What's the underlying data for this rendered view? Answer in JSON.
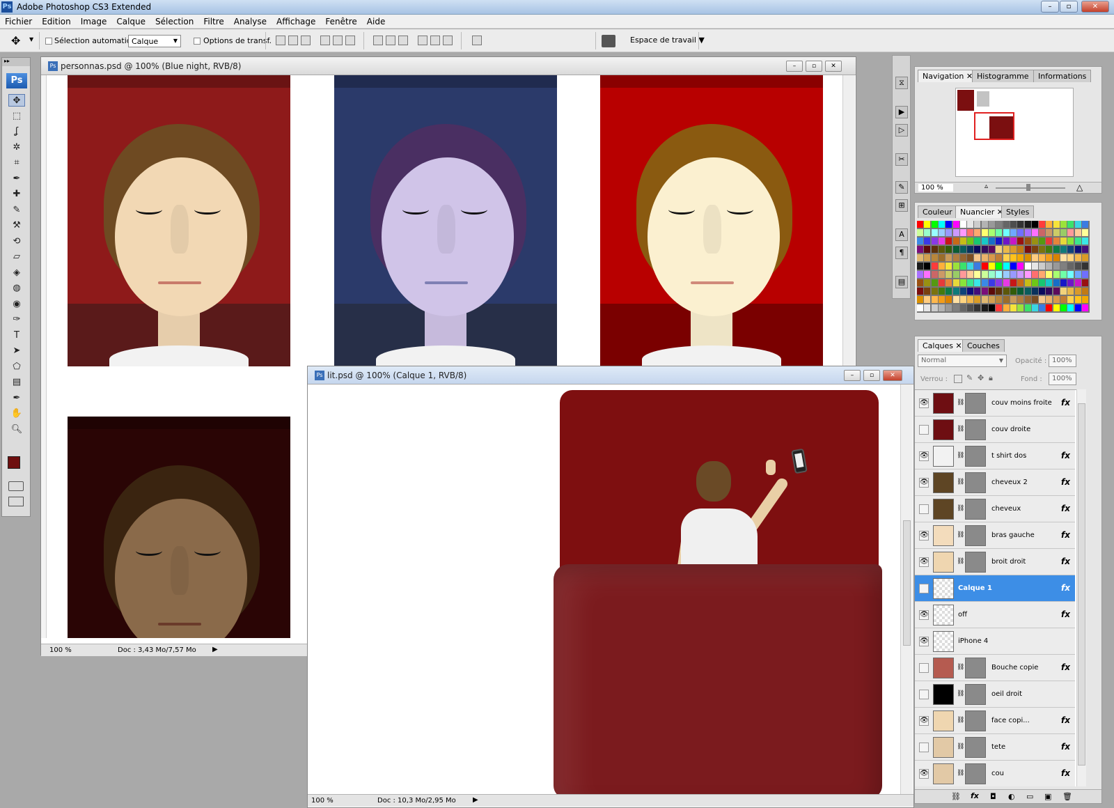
{
  "app": {
    "title": "Adobe Photoshop CS3 Extended",
    "icon": "ps-icon"
  },
  "window_controls": {
    "minimize": "–",
    "maximize": "▫",
    "close": "✕"
  },
  "menu": [
    "Fichier",
    "Edition",
    "Image",
    "Calque",
    "Sélection",
    "Filtre",
    "Analyse",
    "Affichage",
    "Fenêtre",
    "Aide"
  ],
  "options": {
    "auto_select_label": "Sélection automatique :",
    "auto_select_value": "Calque",
    "transform_label": "Options de transf.",
    "workspace_label": "Espace de travail ▼"
  },
  "toolbox": {
    "logo": "Ps",
    "tools": [
      "move-tool",
      "marquee-tool",
      "lasso-tool",
      "magic-wand-tool",
      "crop-tool",
      "eyedropper-tool",
      "healing-brush-tool",
      "brush-tool",
      "clone-stamp-tool",
      "history-brush-tool",
      "eraser-tool",
      "paint-bucket-tool",
      "blur-tool",
      "dodge-tool",
      "pen-tool",
      "type-tool",
      "path-selection-tool",
      "shape-tool",
      "notes-tool",
      "eyedropper-2-tool",
      "hand-tool",
      "zoom-tool"
    ],
    "foreground": "#6e0f0f",
    "background": "#d9d9d9"
  },
  "doc1": {
    "title": "personnas.psd @ 100% (Blue night, RVB/8)",
    "zoom": "100 %",
    "doc_info": "Doc : 3,43 Mo/7,57 Mo",
    "portraits": [
      {
        "bg": "#8e1a1a",
        "lower": "#5a1a1a",
        "hair": "#6e4a22",
        "face": "#f2d8b4",
        "lips": "#c87a6a"
      },
      {
        "bg": "#2b3a6a",
        "lower": "#272f48",
        "hair": "#4a2f62",
        "face": "#d0c4e8",
        "lips": "#7f80b4"
      },
      {
        "bg": "#b80000",
        "lower": "#7a0000",
        "hair": "#8a5a10",
        "face": "#fbf0d0",
        "lips": "#d08a7a"
      },
      {
        "bg": "#2a0505",
        "lower": "#1f0404",
        "hair": "#3a2410",
        "face": "#8a6a4a",
        "lips": "#6a3a2a"
      }
    ]
  },
  "doc2": {
    "title": "lit.psd @ 100% (Calque 1, RVB/8)",
    "zoom": "100 %",
    "doc_info": "Doc : 10,3 Mo/2,95 Mo",
    "bed_color": "#7e0f10",
    "blanket_color": "#7b1b1e",
    "shirt_color": "#f0f0f0",
    "hair_color": "#6a4a26",
    "skin_color": "#e9cfa6"
  },
  "nav_panel": {
    "tabs": [
      "Navigation",
      "Histogramme",
      "Informations"
    ],
    "zoom": "100 %"
  },
  "swatch_panel": {
    "tabs": [
      "Couleur",
      "Nuancier",
      "Styles"
    ]
  },
  "layers_panel": {
    "tabs": [
      "Calques",
      "Couches"
    ],
    "blend_mode": "Normal",
    "opacity_label": "Opacité :",
    "opacity": "100%",
    "lock_label": "Verrou :",
    "fill_label": "Fond :",
    "fill": "100%",
    "layers": [
      {
        "name": "couv moins froite",
        "visible": true,
        "thumb": "#6e0e12",
        "mask": true,
        "fx": true
      },
      {
        "name": "couv droite",
        "visible": false,
        "thumb": "#6e0e12",
        "mask": true,
        "fx": false
      },
      {
        "name": "t shirt dos",
        "visible": true,
        "thumb": "#f2f2f2",
        "mask": true,
        "fx": true
      },
      {
        "name": "cheveux 2",
        "visible": true,
        "thumb": "#5e4524",
        "mask": true,
        "fx": true
      },
      {
        "name": "cheveux",
        "visible": false,
        "thumb": "#5e4524",
        "mask": true,
        "fx": true
      },
      {
        "name": "bras gauche",
        "visible": true,
        "thumb": "#f3dcbc",
        "mask": true,
        "fx": true
      },
      {
        "name": "broit droit",
        "visible": true,
        "thumb": "#efd6b0",
        "mask": true,
        "fx": true
      },
      {
        "name": "Calque 1",
        "visible": false,
        "thumb": "checker",
        "mask": false,
        "fx": true,
        "selected": true
      },
      {
        "name": "off",
        "visible": true,
        "thumb": "checker",
        "mask": false,
        "fx": true
      },
      {
        "name": "iPhone 4",
        "visible": true,
        "thumb": "checker",
        "mask": false,
        "fx": false
      },
      {
        "name": "Bouche copie",
        "visible": false,
        "thumb": "#b55b50",
        "mask": true,
        "fx": true
      },
      {
        "name": "oeil droit",
        "visible": false,
        "thumb": "#000000",
        "mask": true,
        "fx": false
      },
      {
        "name": "face copi...",
        "visible": true,
        "thumb": "#efd6b0",
        "mask": true,
        "fx": true
      },
      {
        "name": "tete",
        "visible": false,
        "thumb": "#e2c9a6",
        "mask": true,
        "fx": true
      },
      {
        "name": "cou",
        "visible": true,
        "thumb": "#e2c9a6",
        "mask": true,
        "fx": true
      }
    ]
  }
}
